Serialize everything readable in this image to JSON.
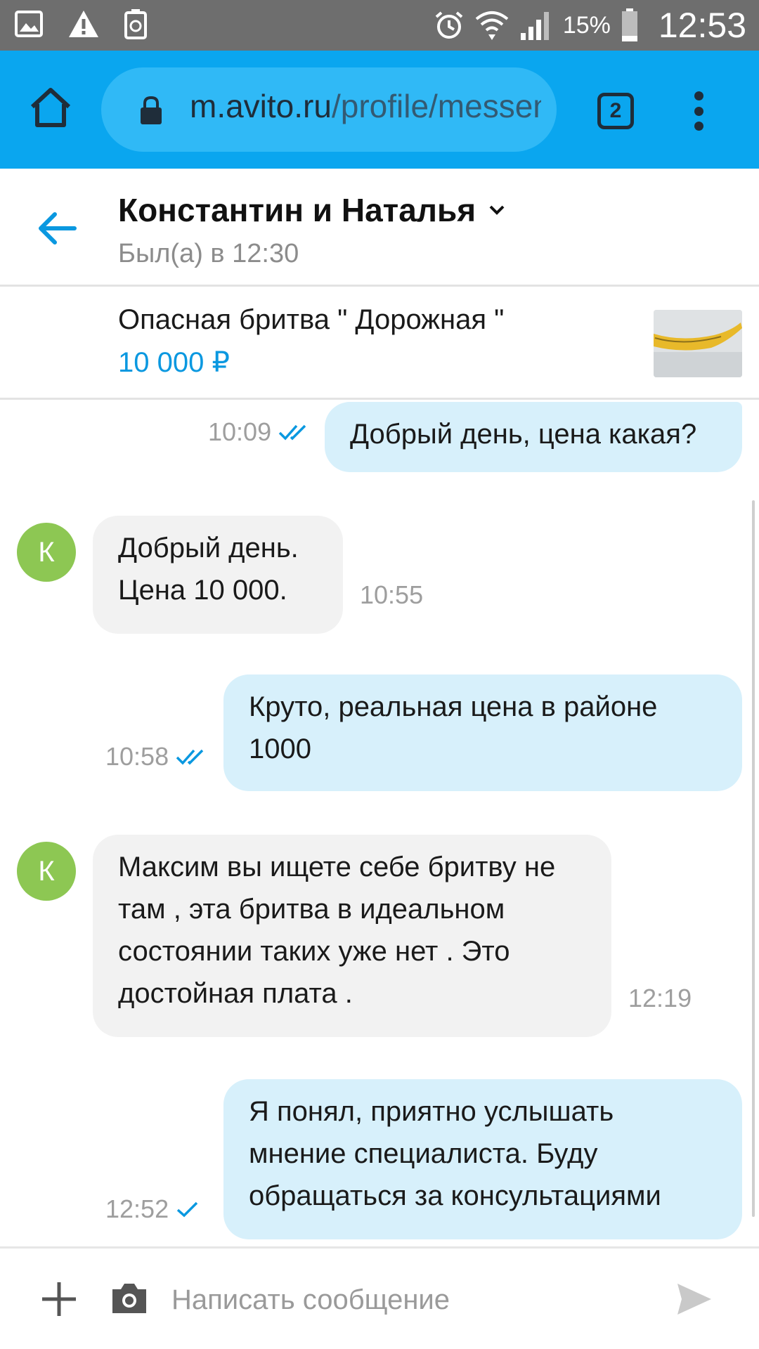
{
  "status_bar": {
    "battery_percent": "15%",
    "time": "12:53"
  },
  "browser": {
    "url_host": "m.avito.ru",
    "url_path": "/profile/messenger",
    "tab_count": "2"
  },
  "chat": {
    "title": "Константин и Наталья",
    "status": "Был(а) в 12:30"
  },
  "item": {
    "title": "Опасная бритва \" Дорожная \"",
    "price": "10 000 ₽"
  },
  "avatar_letter": "К",
  "messages": [
    {
      "dir": "out",
      "text": "Добрый день, цена какая?",
      "time": "10:09",
      "status": "read"
    },
    {
      "dir": "in",
      "lines": [
        "Добрый день.",
        "Цена 10 000."
      ],
      "time": "10:55"
    },
    {
      "dir": "out",
      "lines": [
        "Круто, реальная цена в районе",
        "1000"
      ],
      "time": "10:58",
      "status": "read"
    },
    {
      "dir": "in",
      "lines": [
        "Максим вы ищете себе бритву не",
        "там , эта бритва в идеальном",
        "состоянии таких уже нет .  Это",
        "достойная  плата  ."
      ],
      "time": "12:19"
    },
    {
      "dir": "out",
      "lines": [
        "Я понял, приятно услышать",
        "мнение специалиста. Буду",
        "обращаться за консультациями"
      ],
      "time": "12:52",
      "status": "sent"
    }
  ],
  "composer": {
    "placeholder": "Написать сообщение"
  },
  "colors": {
    "browser_bar": "#0aa6ef",
    "accent": "#0a98e0",
    "outgoing_bubble": "#d7f0fb",
    "incoming_bubble": "#f2f2f2",
    "avatar": "#8dc753",
    "status_bar": "#6e6e6e"
  }
}
